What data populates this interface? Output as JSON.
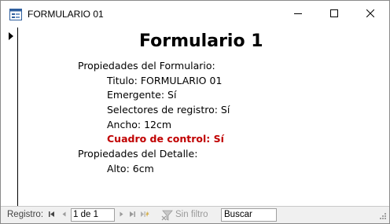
{
  "window": {
    "title": "FORMULARIO 01",
    "icon": "form-icon",
    "controls": [
      "minimize-icon",
      "maximize-icon",
      "close-icon"
    ]
  },
  "form": {
    "heading": "Formulario 1",
    "lines": [
      {
        "text": "Propiedades del Formulario:",
        "indent": 0,
        "highlight": false
      },
      {
        "text": "Titulo: FORMULARIO 01",
        "indent": 1,
        "highlight": false
      },
      {
        "text": "Emergente: Sí",
        "indent": 1,
        "highlight": false
      },
      {
        "text": "Selectores de registro: Sí",
        "indent": 1,
        "highlight": false
      },
      {
        "text": "Ancho: 12cm",
        "indent": 1,
        "highlight": false
      },
      {
        "text": "Cuadro de control: Sí",
        "indent": 1,
        "highlight": true
      },
      {
        "text": "Propiedades del Detalle:",
        "indent": 0,
        "highlight": false
      },
      {
        "text": "Alto: 6cm",
        "indent": 1,
        "highlight": false
      }
    ],
    "highlight_color": "#c00000"
  },
  "navigation": {
    "label": "Registro:",
    "record_value": "1 de 1",
    "filter_label": "Sin filtro",
    "search_placeholder": "Buscar",
    "icons": [
      "first-record-icon",
      "previous-record-icon",
      "next-record-icon",
      "last-record-icon",
      "new-record-icon",
      "filter-icon"
    ]
  }
}
